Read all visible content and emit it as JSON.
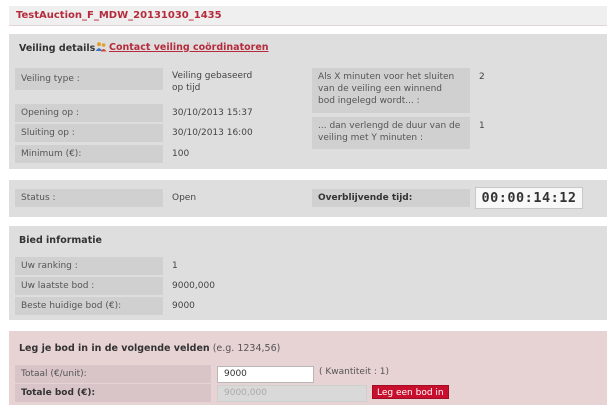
{
  "title": "TestAuction_F_MDW_20131030_1435",
  "details": {
    "heading": "Veiling details",
    "contact_link": "Contact veiling coördinatoren",
    "rows": [
      {
        "label": "Veiling type :",
        "value": "Veiling gebaseerd\nop tijd"
      },
      {
        "label": "Opening op :",
        "value": "30/10/2013 15:37"
      },
      {
        "label": "Sluiting op :",
        "value": "30/10/2013 16:00"
      },
      {
        "label": "Minimum (€):",
        "value": "100"
      }
    ],
    "extension_rows": [
      {
        "label": "Als X minuten voor het sluiten\nvan de veiling een winnend\nbod ingelegd wordt... :",
        "value": "2"
      },
      {
        "label": "... dan verlengd de duur van de\nveiling met Y minuten :",
        "value": "1"
      }
    ]
  },
  "status": {
    "label": "Status :",
    "value": "Open",
    "remaining_label": "Overblijvende tijd:",
    "remaining_value": "00:00:14:12"
  },
  "bid_info": {
    "heading": "Bied informatie",
    "rows": [
      {
        "label": "Uw ranking :",
        "value": "1"
      },
      {
        "label": "Uw laatste bod :",
        "value": "9000,000"
      },
      {
        "label": "Beste huidige bod (€):",
        "value": "9000"
      }
    ]
  },
  "bid_form": {
    "heading_bold": "Leg je bod in in de volgende velden",
    "heading_hint": " (e.g. 1234,56)",
    "total_unit_label": "Totaal (€/unit):",
    "total_unit_value": "9000",
    "quantity_hint": "( Kwantiteit : 1)",
    "total_bid_label": "Totale bod (€):",
    "total_bid_value": "9000,000",
    "submit_label": "Leg een bod in"
  },
  "colors": {
    "accent": "#b52b3c",
    "button": "#c8102e",
    "panel": "#dedede",
    "label_bg": "#d0d0d0",
    "form_panel": "#e7d2d4"
  }
}
